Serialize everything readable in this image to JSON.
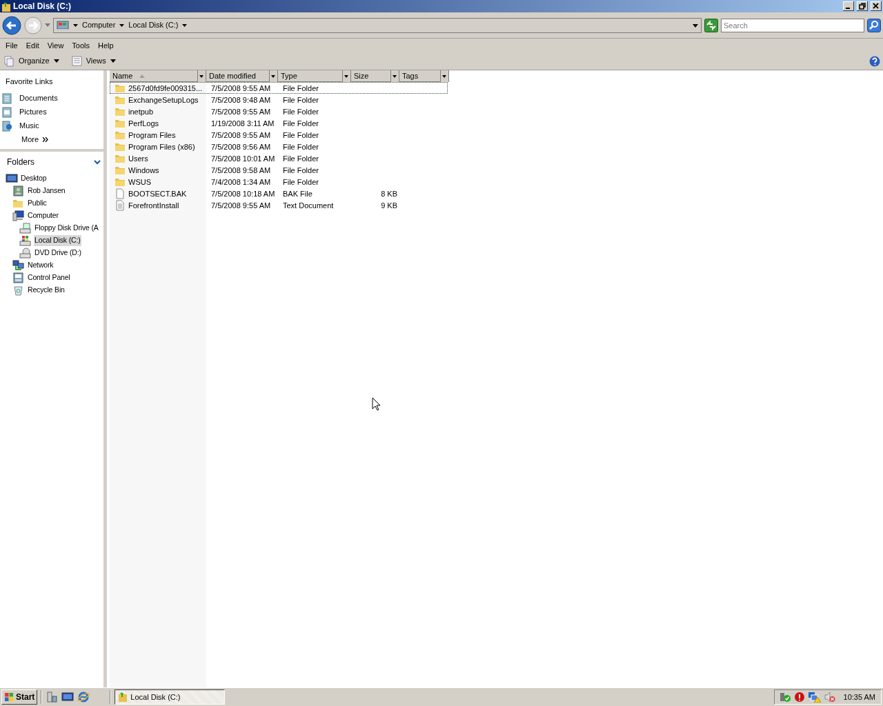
{
  "window": {
    "title": "Local Disk (C:)"
  },
  "address": {
    "crumbs": [
      "Computer",
      "Local Disk (C:)"
    ],
    "search_placeholder": "Search"
  },
  "menu": [
    "File",
    "Edit",
    "View",
    "Tools",
    "Help"
  ],
  "toolbar": [
    {
      "label": "Organize",
      "kind": "organize"
    },
    {
      "label": "Views",
      "kind": "views"
    }
  ],
  "favorite_links": {
    "title": "Favorite Links",
    "items": [
      {
        "label": "Documents",
        "kind": "documents"
      },
      {
        "label": "Pictures",
        "kind": "pictures"
      },
      {
        "label": "Music",
        "kind": "music"
      }
    ],
    "more": "More"
  },
  "folders": {
    "title": "Folders",
    "expanded": true,
    "tree": [
      {
        "label": "Desktop",
        "kind": "desktop",
        "selected": false,
        "children": [
          {
            "label": "Rob Jansen",
            "kind": "user",
            "selected": false
          },
          {
            "label": "Public",
            "kind": "folder",
            "selected": false
          },
          {
            "label": "Computer",
            "kind": "computer",
            "selected": false,
            "children": [
              {
                "label": "Floppy Disk Drive (A",
                "kind": "floppy",
                "selected": false
              },
              {
                "label": "Local Disk (C:)",
                "kind": "disk",
                "selected": true
              },
              {
                "label": "DVD Drive (D:)",
                "kind": "dvd",
                "selected": false
              }
            ]
          },
          {
            "label": "Network",
            "kind": "network",
            "selected": false
          },
          {
            "label": "Control Panel",
            "kind": "control",
            "selected": false
          },
          {
            "label": "Recycle Bin",
            "kind": "recycle",
            "selected": false
          }
        ]
      }
    ]
  },
  "table": {
    "columns": [
      {
        "label": "Name",
        "sorted": true
      },
      {
        "label": "Date modified",
        "sorted": false
      },
      {
        "label": "Type",
        "sorted": false
      },
      {
        "label": "Size",
        "sorted": false
      },
      {
        "label": "Tags",
        "sorted": false
      }
    ],
    "rows": [
      {
        "name": "2567d0fd9fe009315...",
        "date": "7/5/2008 9:55 AM",
        "type": "File Folder",
        "kind": "folder",
        "focused": true
      },
      {
        "name": "ExchangeSetupLogs",
        "date": "7/5/2008 9:48 AM",
        "type": "File Folder",
        "kind": "folder",
        "focused": false
      },
      {
        "name": "inetpub",
        "date": "7/5/2008 9:55 AM",
        "type": "File Folder",
        "kind": "folder",
        "focused": false
      },
      {
        "name": "PerfLogs",
        "date": "1/19/2008 3:11 AM",
        "type": "File Folder",
        "kind": "folder",
        "focused": false
      },
      {
        "name": "Program Files",
        "date": "7/5/2008 9:55 AM",
        "type": "File Folder",
        "kind": "folder",
        "focused": false
      },
      {
        "name": "Program Files (x86)",
        "date": "7/5/2008 9:56 AM",
        "type": "File Folder",
        "kind": "folder",
        "focused": false
      },
      {
        "name": "Users",
        "date": "7/5/2008 10:01 AM",
        "type": "File Folder",
        "kind": "folder",
        "focused": false
      },
      {
        "name": "Windows",
        "date": "7/5/2008 9:58 AM",
        "type": "File Folder",
        "kind": "folder",
        "focused": false
      },
      {
        "name": "WSUS",
        "date": "7/4/2008 1:34 AM",
        "type": "File Folder",
        "kind": "folder",
        "focused": false
      },
      {
        "name": "BOOTSECT.BAK",
        "date": "7/5/2008 10:18 AM",
        "type": "BAK File",
        "size": "8 KB",
        "kind": "file",
        "focused": false
      },
      {
        "name": "ForefrontInstall",
        "date": "7/5/2008 9:55 AM",
        "type": "Text Document",
        "size": "9 KB",
        "kind": "text",
        "focused": false
      }
    ]
  },
  "taskbar": {
    "start": "Start",
    "tasks": [
      {
        "label": "Local Disk (C:)",
        "selected": true
      }
    ],
    "clock": "10:35 AM"
  }
}
